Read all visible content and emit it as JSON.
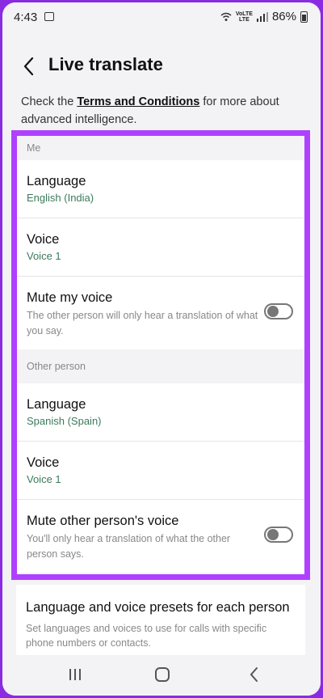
{
  "status": {
    "time": "4:43",
    "lte_top": "VoLTE",
    "lte_bottom": "LTE",
    "battery": "86%"
  },
  "header": {
    "title": "Live translate"
  },
  "description": {
    "prefix": "Check the ",
    "link": "Terms and Conditions",
    "suffix": " for more about advanced intelligence."
  },
  "me": {
    "section": "Me",
    "language_label": "Language",
    "language_value": "English (India)",
    "voice_label": "Voice",
    "voice_value": "Voice 1",
    "mute_label": "Mute my voice",
    "mute_desc": "The other person will only hear a translation of what you say."
  },
  "other": {
    "section": "Other person",
    "language_label": "Language",
    "language_value": "Spanish (Spain)",
    "voice_label": "Voice",
    "voice_value": "Voice 1",
    "mute_label": "Mute other person's voice",
    "mute_desc": "You'll only hear a translation of what the other person says."
  },
  "presets": {
    "title": "Language and voice presets for each person",
    "desc": "Set languages and voices to use for calls with specific phone numbers or contacts."
  },
  "colors": {
    "highlight": "#b040ff",
    "accent_text": "#3b7a5c"
  },
  "icons": {
    "back": "back-arrow-icon",
    "recents": "recents-icon",
    "home": "home-icon",
    "nav_back": "nav-back-icon"
  }
}
